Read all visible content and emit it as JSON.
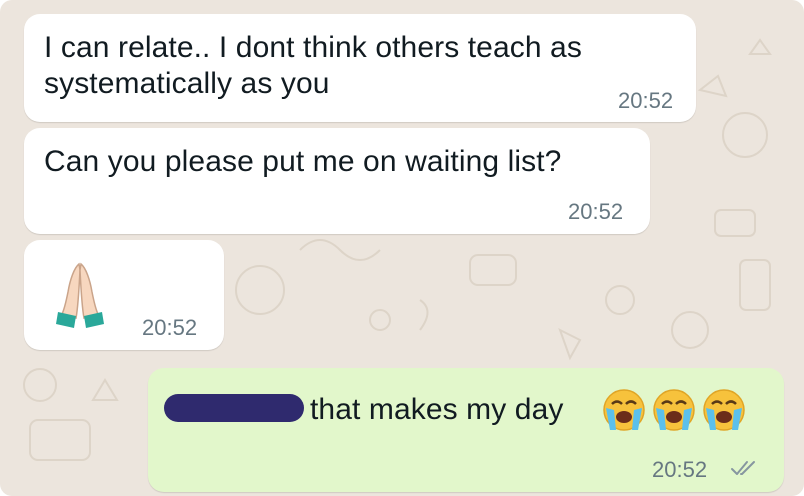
{
  "chat": {
    "messages": [
      {
        "direction": "incoming",
        "text": "I can relate.. I dont think others teach as\nsystematically as you",
        "time": "20:52"
      },
      {
        "direction": "incoming",
        "text": "Can you please put me on waiting list?",
        "time": "20:52"
      },
      {
        "direction": "incoming",
        "emoji": "folded-hands",
        "time": "20:52"
      },
      {
        "direction": "outgoing",
        "redacted_name": true,
        "text": "that makes my day",
        "emoji": [
          "loudly-crying-face",
          "loudly-crying-face",
          "loudly-crying-face"
        ],
        "time": "20:52",
        "status": "double-check-read-icon"
      }
    ]
  },
  "colors": {
    "wallpaper": "#ece5dd",
    "incoming_bubble": "#ffffff",
    "outgoing_bubble": "#e2f7cb",
    "timestamp": "#667781",
    "redaction": "#2f2a6e"
  }
}
